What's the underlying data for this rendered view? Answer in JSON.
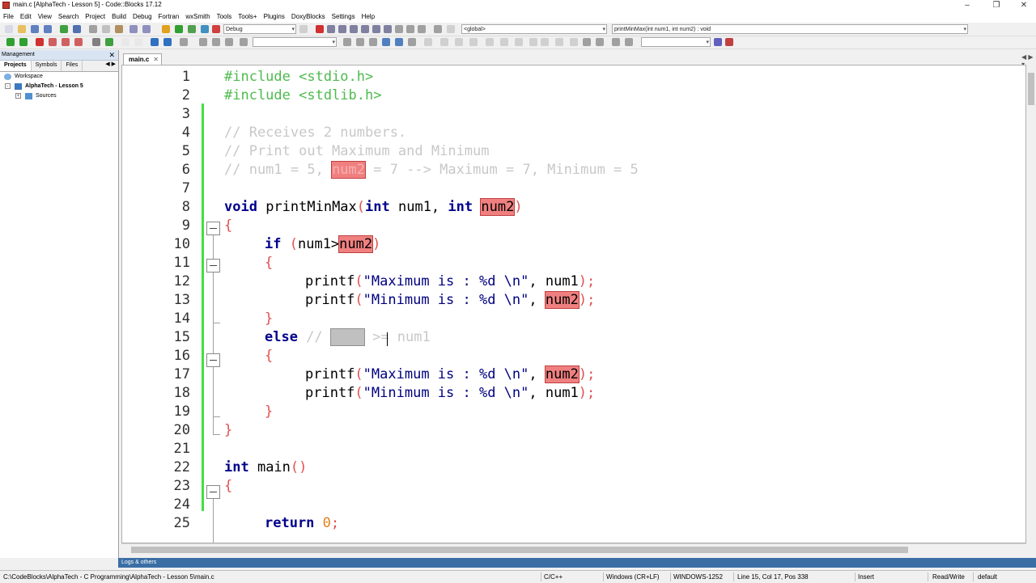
{
  "window": {
    "title": "main.c [AlphaTech - Lesson 5] - Code::Blocks 17.12"
  },
  "menu": [
    "File",
    "Edit",
    "View",
    "Search",
    "Project",
    "Build",
    "Debug",
    "Fortran",
    "wxSmith",
    "Tools",
    "Tools+",
    "Plugins",
    "DoxyBlocks",
    "Settings",
    "Help"
  ],
  "toolbar": {
    "build_target": "Debug",
    "scope": "<global>",
    "function": "printMinMax(int num1, int num2) : void"
  },
  "management": {
    "header": "Management",
    "tabs": [
      "Projects",
      "Symbols",
      "Files"
    ],
    "tree": {
      "workspace": "Workspace",
      "project": "AlphaTech - Lesson 5",
      "folder": "Sources"
    }
  },
  "editor": {
    "tab": "main.c",
    "line_numbers": [
      "1",
      "2",
      "3",
      "4",
      "5",
      "6",
      "7",
      "8",
      "9",
      "10",
      "11",
      "12",
      "13",
      "14",
      "15",
      "16",
      "17",
      "18",
      "19",
      "20",
      "21",
      "22",
      "23",
      "24",
      "25"
    ],
    "lines": {
      "l1": "#include <stdio.h>",
      "l2": "#include <stdlib.h>",
      "l4": "// Receives 2 numbers.",
      "l5": "// Print out Maximum and Minimum",
      "l6a": "// num1 = 5, ",
      "l6b": "num2",
      "l6c": " = 7 --> Maximum = 7, Minimum = 5",
      "l8a": "void",
      "l8b": " printMinMax",
      "l8c": "(",
      "l8d": "int",
      "l8e": " num1, ",
      "l8f": "int",
      "l8g": " ",
      "l8h": "num2",
      "l8i": ")",
      "l9": "{",
      "l10a": "if",
      "l10b": " ",
      "l10c": "(",
      "l10d": "num1>",
      "l10e": "num2",
      "l10f": ")",
      "l11": "{",
      "l12a": "printf",
      "l12b": "(",
      "l12c": "\"Maximum is : %d \\n\"",
      "l12d": ", num1",
      "l12e": ")",
      "l12f": ";",
      "l13a": "printf",
      "l13b": "(",
      "l13c": "\"Minimum is : %d \\n\"",
      "l13d": ", ",
      "l13e": "num2",
      "l13f": ")",
      "l13g": ";",
      "l14": "}",
      "l15a": "else",
      "l15b": " // ",
      "l15c": "num2",
      "l15d": " >= num1",
      "l16": "{",
      "l17a": "printf",
      "l17b": "(",
      "l17c": "\"Maximum is : %d \\n\"",
      "l17d": ", ",
      "l17e": "num2",
      "l17f": ")",
      "l17g": ";",
      "l18a": "printf",
      "l18b": "(",
      "l18c": "\"Minimum is : %d \\n\"",
      "l18d": ", num1",
      "l18e": ")",
      "l18f": ";",
      "l19": "}",
      "l20": "}",
      "l22a": "int",
      "l22b": " main",
      "l22c": "()",
      "l23": "{",
      "l25a": "return",
      "l25b": " ",
      "l25c": "0",
      "l25d": ";"
    }
  },
  "logs": {
    "label": "Logs & others"
  },
  "status": {
    "path": "C:\\CodeBlocks\\AlphaTech - C Programming\\AlphaTech - Lesson 5\\main.c",
    "language": "C/C++",
    "eol": "Windows (CR+LF)",
    "encoding": "WINDOWS-1252",
    "position": "Line 15, Col 17, Pos 338",
    "mode": "Insert",
    "access": "Read/Write",
    "profile": "default"
  },
  "colors": {
    "preprocessor": "#4dbb4d",
    "comment": "#c8c8c8",
    "keyword": "#00008b",
    "brace": "#e05050",
    "highlight": "#f08080",
    "changebar": "#40e040"
  }
}
